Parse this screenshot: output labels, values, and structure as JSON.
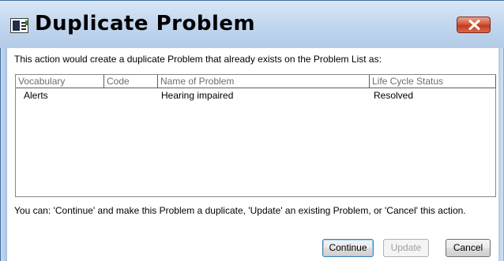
{
  "window": {
    "title": "Duplicate Problem",
    "icon": "problem-list-icon",
    "close_icon": "close-x-icon",
    "close_button_color": "#c43a1d"
  },
  "message": "This action would create a duplicate Problem that already exists on the Problem List as:",
  "table": {
    "columns": [
      "Vocabulary",
      "Code",
      "Name of Problem",
      "Life Cycle Status"
    ],
    "rows": [
      {
        "vocabulary": "Alerts",
        "code": "",
        "name": "Hearing impaired",
        "status": "Resolved"
      }
    ]
  },
  "footer_text": "You can:  'Continue' and make this Problem a duplicate, 'Update' an existing Problem, or 'Cancel' this action.",
  "buttons": {
    "continue": "Continue",
    "update": "Update",
    "cancel": "Cancel",
    "update_enabled": false
  }
}
